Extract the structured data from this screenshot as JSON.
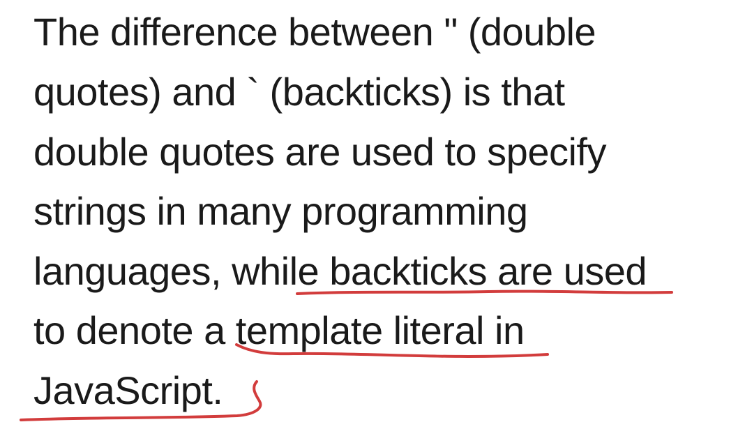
{
  "text": {
    "lines": [
      "The difference between \" (double",
      "quotes) and ` (backticks) is that",
      "double quotes are used to specify",
      "strings in many programming",
      "languages, while backticks are used",
      "to denote a template literal in",
      "JavaScript."
    ]
  },
  "colors": {
    "text": "#1a1a1a",
    "background": "#ffffff",
    "annotation": "#d23c3c"
  },
  "annotations": [
    {
      "type": "underline",
      "target": "backticks are used"
    },
    {
      "type": "underline",
      "target": "a template literal"
    },
    {
      "type": "underline",
      "target": "JavaScript."
    }
  ]
}
